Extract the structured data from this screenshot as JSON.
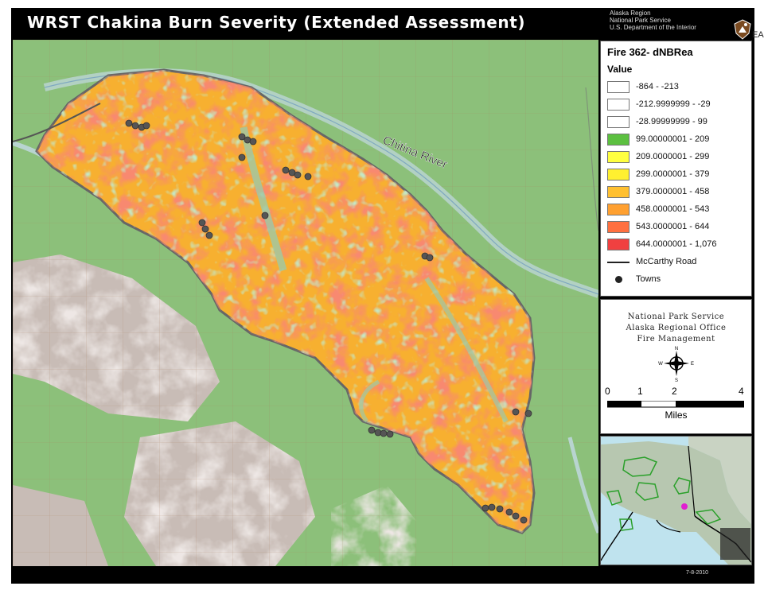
{
  "title": "WRST Chakina Burn Severity (Extended Assessment)",
  "agency": {
    "line1": "Alaska Region",
    "line2": "National Park Service",
    "line3": "U.S. Department of the Interior",
    "edge_text": "EA"
  },
  "map": {
    "river_label": "Chitina River",
    "colors": {
      "background": "#8cc07a",
      "severity_high": "#f04028",
      "severity_mid": "#f6a030",
      "severity_low": "#ffef30",
      "unburned": "#9cc9a8",
      "road": "#555555"
    }
  },
  "legend": {
    "title": "Fire 362- dNBRea",
    "subtitle": "Value",
    "classes": [
      {
        "label": "-864 - -213",
        "color": "#ffffff"
      },
      {
        "label": "-212.9999999 - -29",
        "color": "#ffffff"
      },
      {
        "label": "-28.99999999 - 99",
        "color": "#ffffff"
      },
      {
        "label": "99.00000001 - 209",
        "color": "#5cc040"
      },
      {
        "label": "209.0000001 - 299",
        "color": "#ffff40"
      },
      {
        "label": "299.0000001 - 379",
        "color": "#fff030"
      },
      {
        "label": "379.0000001 - 458",
        "color": "#ffc030"
      },
      {
        "label": "458.0000001 - 543",
        "color": "#ffa030"
      },
      {
        "label": "543.0000001 - 644",
        "color": "#ff7040"
      },
      {
        "label": "644.0000001 - 1,076",
        "color": "#f04040"
      }
    ],
    "road_label": "McCarthy Road",
    "towns_label": "Towns"
  },
  "credit": {
    "line1": "National Park Service",
    "line2": "Alaska Regional Office",
    "line3": "Fire Management",
    "north": "N",
    "south": "S",
    "east": "E",
    "west": "W"
  },
  "scale": {
    "ticks": [
      "0",
      "1",
      "2",
      "4"
    ],
    "unit": "Miles"
  },
  "date": "7-8-2010"
}
